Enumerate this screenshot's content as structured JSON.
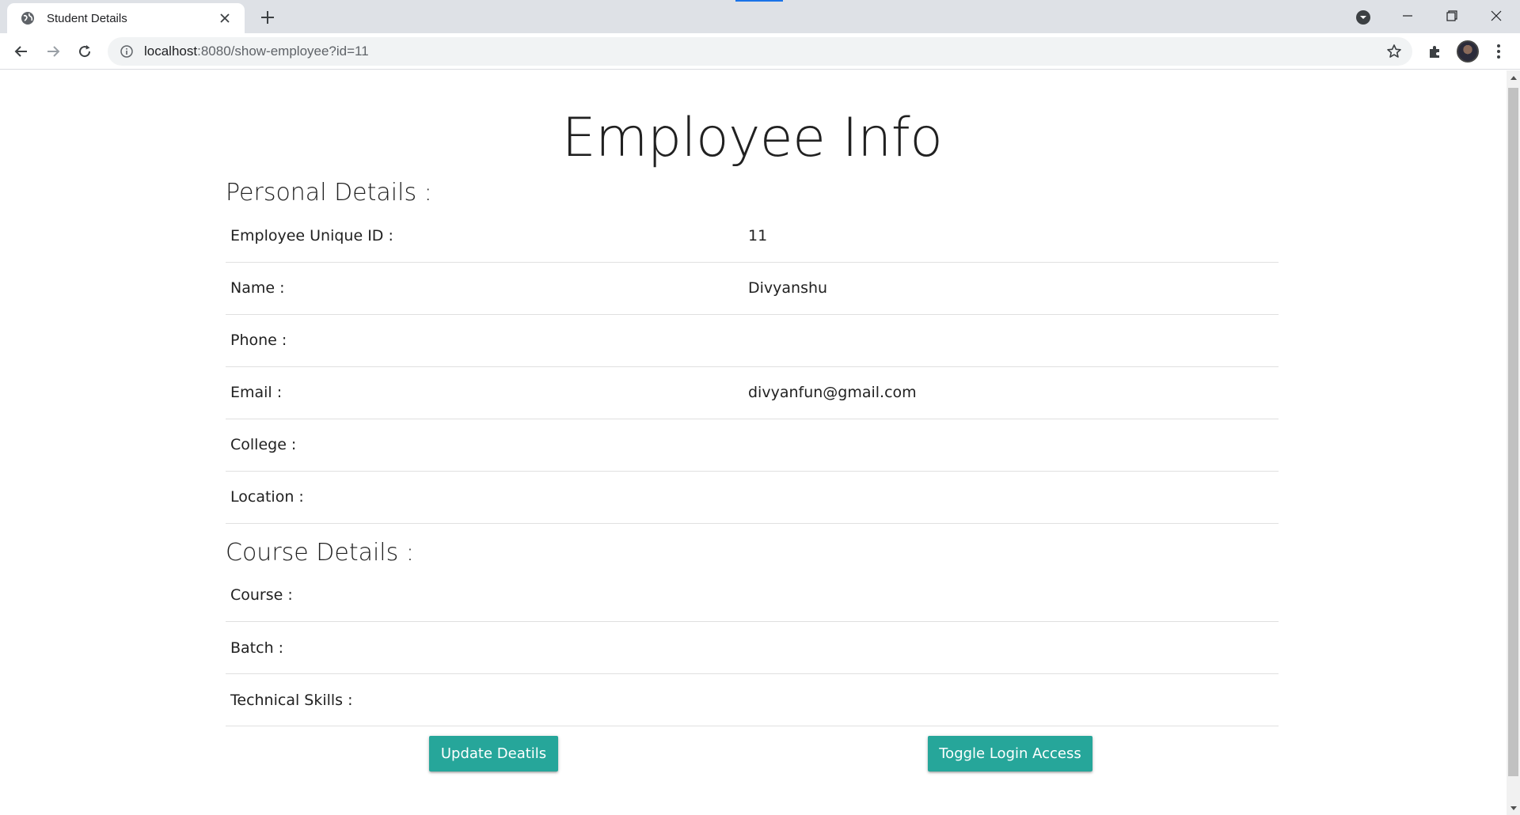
{
  "browser": {
    "tab_title": "Student Details",
    "url_host": "localhost",
    "url_rest": ":8080/show-employee?id=11"
  },
  "page": {
    "title": "Employee Info",
    "personal_heading": "Personal Details :",
    "course_heading": "Course Details :",
    "personal_rows": [
      {
        "label": "Employee Unique ID :",
        "value": "11"
      },
      {
        "label": "Name :",
        "value": "Divyanshu"
      },
      {
        "label": "Phone :",
        "value": ""
      },
      {
        "label": "Email :",
        "value": "divyanfun@gmail.com"
      },
      {
        "label": "College :",
        "value": ""
      },
      {
        "label": "Location :",
        "value": ""
      }
    ],
    "course_rows": [
      {
        "label": "Course :",
        "value": ""
      },
      {
        "label": "Batch :",
        "value": ""
      },
      {
        "label": "Technical Skills :",
        "value": ""
      }
    ],
    "buttons": {
      "update": "Update Deatils",
      "toggle": "Toggle Login Access"
    }
  },
  "colors": {
    "button_bg": "#26a69a",
    "tabstrip_bg": "#dee1e6"
  }
}
